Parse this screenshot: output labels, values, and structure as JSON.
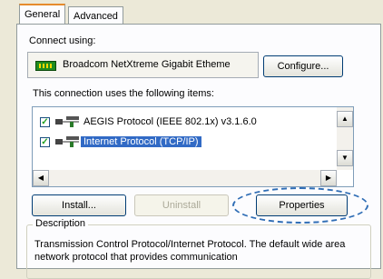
{
  "tabs": [
    {
      "label": "General",
      "active": true
    },
    {
      "label": "Advanced",
      "active": false
    }
  ],
  "connect_using_label": "Connect using:",
  "adapter_name": "Broadcom NetXtreme Gigabit Etheme",
  "configure_label": "Configure...",
  "items_label": "This connection uses the following items:",
  "items": [
    {
      "label": "AEGIS Protocol (IEEE 802.1x) v3.1.6.0",
      "checked": true,
      "selected": false,
      "icon": "network-protocol-icon"
    },
    {
      "label": "Internet Protocol (TCP/IP)",
      "checked": true,
      "selected": true,
      "icon": "network-protocol-icon"
    }
  ],
  "buttons": {
    "install": "Install...",
    "uninstall": "Uninstall",
    "properties": "Properties"
  },
  "description_legend": "Description",
  "description_text": "Transmission Control Protocol/Internet Protocol. The default wide area network protocol that provides communication",
  "colors": {
    "selection": "#316ac5",
    "highlight_ellipse": "#2f6db5",
    "tab_accent": "#e68b2c"
  }
}
